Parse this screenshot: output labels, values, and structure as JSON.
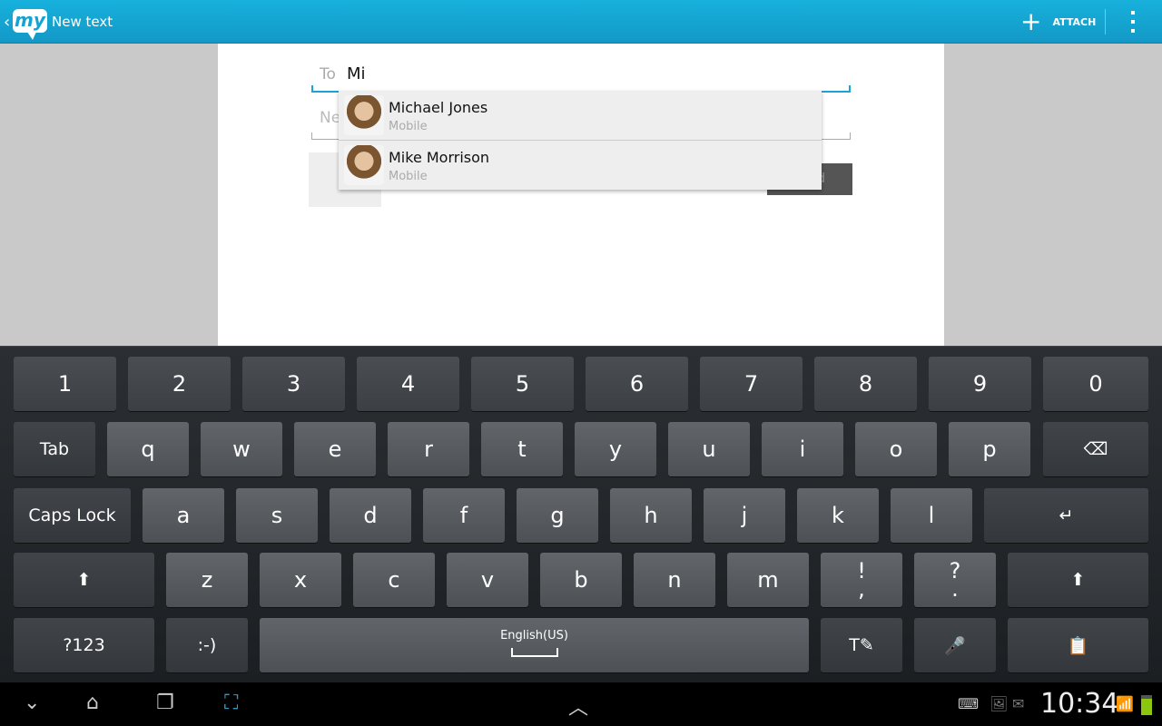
{
  "header": {
    "title": "New text",
    "logo_text": "my",
    "attach_label": "ATTACH"
  },
  "compose": {
    "to_label": "To",
    "to_value": "Mi",
    "message_placeholder": "Ne",
    "send_label": "d"
  },
  "suggestions": [
    {
      "name": "Michael Jones",
      "type": "Mobile"
    },
    {
      "name": "Mike Morrison",
      "type": "Mobile"
    }
  ],
  "keyboard": {
    "rows": [
      [
        "1",
        "2",
        "3",
        "4",
        "5",
        "6",
        "7",
        "8",
        "9",
        "0"
      ],
      [
        "Tab",
        "q",
        "w",
        "e",
        "r",
        "t",
        "y",
        "u",
        "i",
        "o",
        "p",
        "⌫"
      ],
      [
        "Caps Lock",
        "a",
        "s",
        "d",
        "f",
        "g",
        "h",
        "j",
        "k",
        "l",
        "↵"
      ],
      [
        "⬆",
        "z",
        "x",
        "c",
        "v",
        "b",
        "n",
        "m",
        "!\n,",
        "?\n.",
        "⬆"
      ],
      [
        "?123",
        ":-)",
        "English(US)",
        "T✎",
        "🎤",
        "📋"
      ]
    ]
  },
  "status": {
    "time": "10:34"
  },
  "colors": {
    "accent": "#17a9d6",
    "keyboard_bg": "#1f2326"
  }
}
